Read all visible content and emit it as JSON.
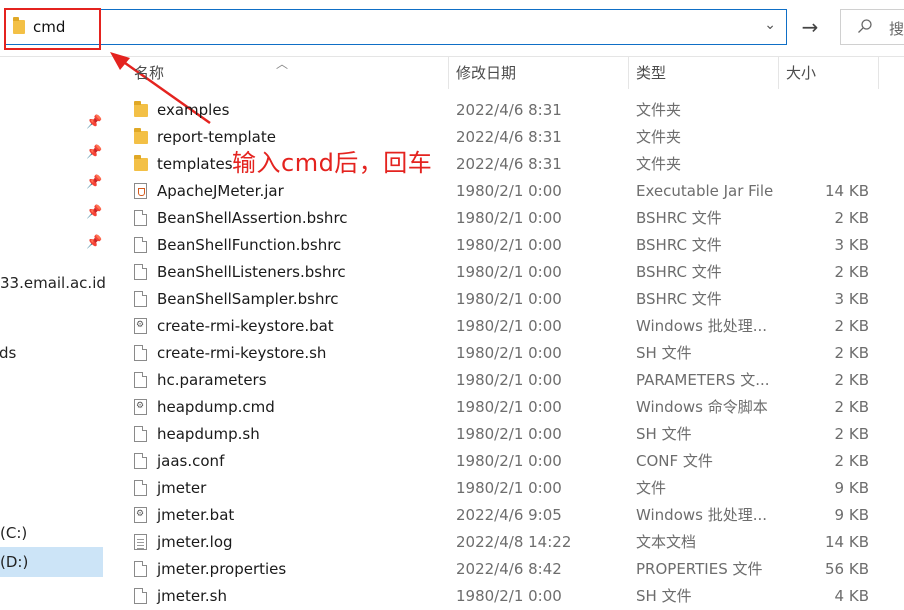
{
  "address_bar": {
    "path_text": "cmd",
    "dropdown_glyph": "⌄"
  },
  "go_button": {
    "glyph": "→"
  },
  "search": {
    "glyph": "⚲",
    "placeholder": "搜"
  },
  "annotation": {
    "text": "输入cmd后，回车",
    "color": "#e4231f"
  },
  "nav": {
    "items": [
      {
        "label": "33.email.ac.id"
      },
      {
        "label": "ds"
      },
      {
        "label": "(C:)"
      },
      {
        "label": "(D:)",
        "selected": true
      }
    ]
  },
  "columns": {
    "name": "名称",
    "date": "修改日期",
    "type": "类型",
    "size": "大小"
  },
  "files": [
    {
      "name": "examples",
      "date": "2022/4/6 8:31",
      "type": "文件夹",
      "size": "",
      "icon": "folder-icon"
    },
    {
      "name": "report-template",
      "date": "2022/4/6 8:31",
      "type": "文件夹",
      "size": "",
      "icon": "folder-icon"
    },
    {
      "name": "templates",
      "date": "2022/4/6 8:31",
      "type": "文件夹",
      "size": "",
      "icon": "folder-icon"
    },
    {
      "name": "ApacheJMeter.jar",
      "date": "1980/2/1 0:00",
      "type": "Executable Jar File",
      "size": "14 KB",
      "icon": "jar-file-icon"
    },
    {
      "name": "BeanShellAssertion.bshrc",
      "date": "1980/2/1 0:00",
      "type": "BSHRC 文件",
      "size": "2 KB",
      "icon": "file-icon"
    },
    {
      "name": "BeanShellFunction.bshrc",
      "date": "1980/2/1 0:00",
      "type": "BSHRC 文件",
      "size": "3 KB",
      "icon": "file-icon"
    },
    {
      "name": "BeanShellListeners.bshrc",
      "date": "1980/2/1 0:00",
      "type": "BSHRC 文件",
      "size": "2 KB",
      "icon": "file-icon"
    },
    {
      "name": "BeanShellSampler.bshrc",
      "date": "1980/2/1 0:00",
      "type": "BSHRC 文件",
      "size": "3 KB",
      "icon": "file-icon"
    },
    {
      "name": "create-rmi-keystore.bat",
      "date": "1980/2/1 0:00",
      "type": "Windows 批处理...",
      "size": "2 KB",
      "icon": "gear-file-icon"
    },
    {
      "name": "create-rmi-keystore.sh",
      "date": "1980/2/1 0:00",
      "type": "SH 文件",
      "size": "2 KB",
      "icon": "file-icon"
    },
    {
      "name": "hc.parameters",
      "date": "1980/2/1 0:00",
      "type": "PARAMETERS 文...",
      "size": "2 KB",
      "icon": "file-icon"
    },
    {
      "name": "heapdump.cmd",
      "date": "1980/2/1 0:00",
      "type": "Windows 命令脚本",
      "size": "2 KB",
      "icon": "gear-file-icon"
    },
    {
      "name": "heapdump.sh",
      "date": "1980/2/1 0:00",
      "type": "SH 文件",
      "size": "2 KB",
      "icon": "file-icon"
    },
    {
      "name": "jaas.conf",
      "date": "1980/2/1 0:00",
      "type": "CONF 文件",
      "size": "2 KB",
      "icon": "file-icon"
    },
    {
      "name": "jmeter",
      "date": "1980/2/1 0:00",
      "type": "文件",
      "size": "9 KB",
      "icon": "file-icon"
    },
    {
      "name": "jmeter.bat",
      "date": "2022/4/6 9:05",
      "type": "Windows 批处理...",
      "size": "9 KB",
      "icon": "gear-file-icon"
    },
    {
      "name": "jmeter.log",
      "date": "2022/4/8 14:22",
      "type": "文本文档",
      "size": "14 KB",
      "icon": "text-file-icon"
    },
    {
      "name": "jmeter.properties",
      "date": "2022/4/6 8:42",
      "type": "PROPERTIES 文件",
      "size": "56 KB",
      "icon": "file-icon"
    },
    {
      "name": "jmeter.sh",
      "date": "1980/2/1 0:00",
      "type": "SH 文件",
      "size": "4 KB",
      "icon": "file-icon"
    }
  ]
}
